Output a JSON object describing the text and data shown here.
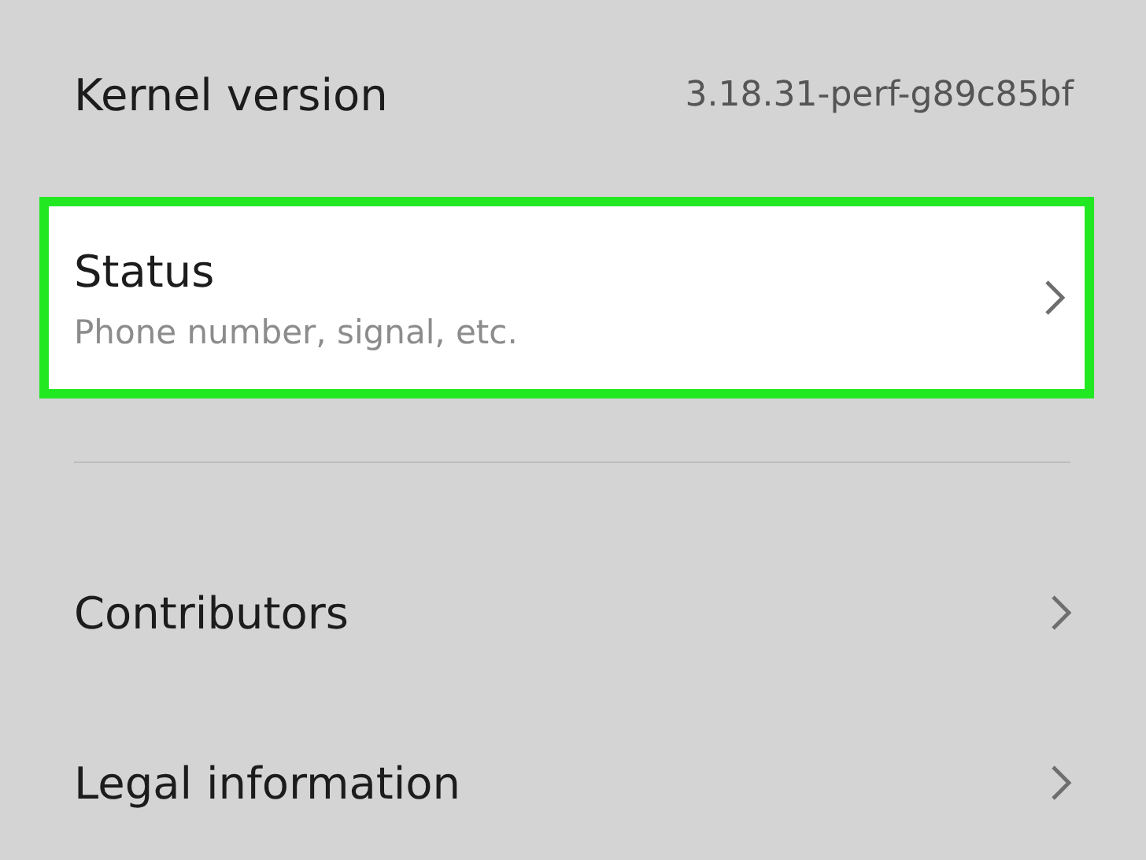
{
  "items": [
    {
      "kind": "info",
      "title": "Kernel version",
      "value": "3.18.31-perf-g89c85bf"
    },
    {
      "kind": "link",
      "title": "Status",
      "subtitle": "Phone number, signal, etc.",
      "highlighted": true
    },
    {
      "kind": "divider"
    },
    {
      "kind": "link",
      "title": "Contributors",
      "highlighted": false
    },
    {
      "kind": "link",
      "title": "Legal information",
      "highlighted": false
    }
  ]
}
